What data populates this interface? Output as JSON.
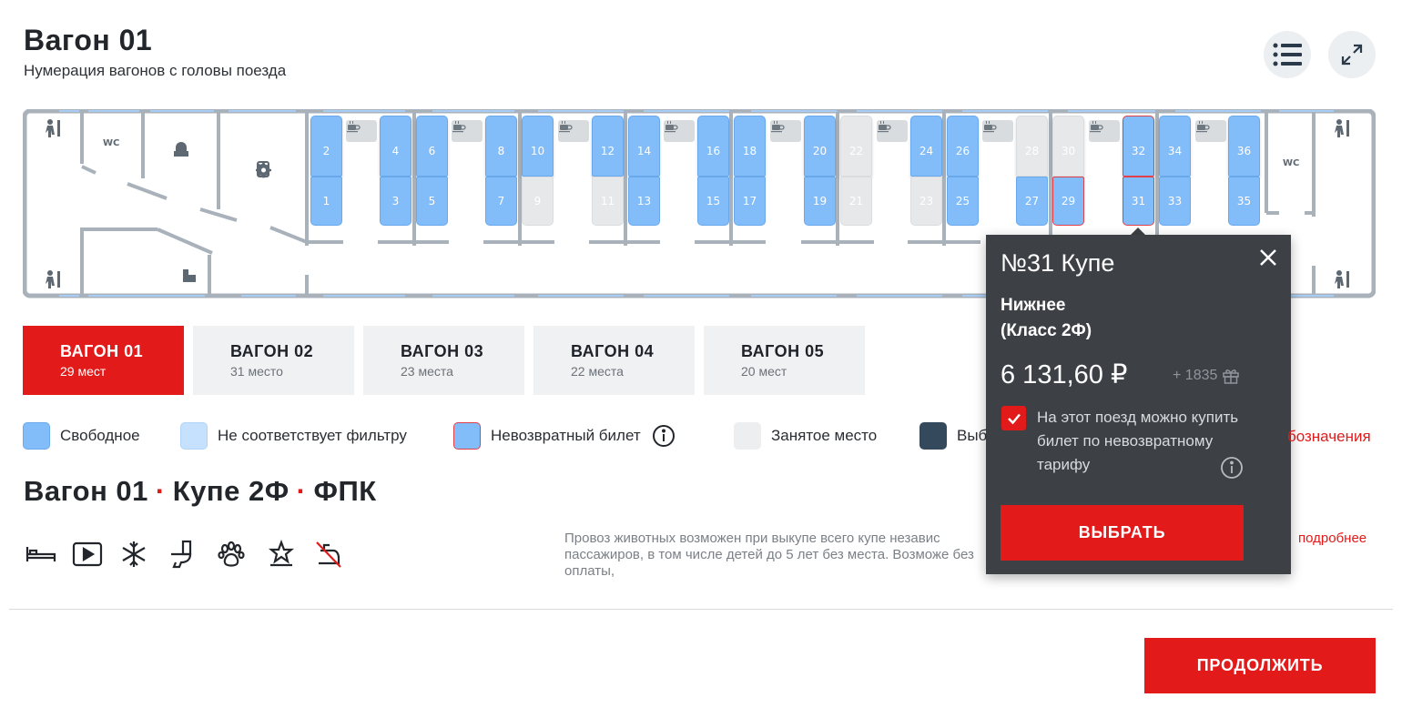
{
  "header": {
    "title": "Вагон 01",
    "subtitle": "Нумерация вагонов с головы поезда",
    "list_icon": "list-icon",
    "expand_icon": "expand-icon"
  },
  "wagon_map": {
    "wc_front": "WC",
    "wc_back": "WC",
    "table_icon": "cup-icon",
    "seats": [
      {
        "n": "2",
        "state": "free"
      },
      {
        "n": "1",
        "state": "free"
      },
      {
        "n": "4",
        "state": "free"
      },
      {
        "n": "3",
        "state": "free"
      },
      {
        "n": "6",
        "state": "free"
      },
      {
        "n": "5",
        "state": "free"
      },
      {
        "n": "8",
        "state": "free"
      },
      {
        "n": "7",
        "state": "free"
      },
      {
        "n": "10",
        "state": "free"
      },
      {
        "n": "9",
        "state": "busy"
      },
      {
        "n": "12",
        "state": "free"
      },
      {
        "n": "11",
        "state": "busy"
      },
      {
        "n": "14",
        "state": "free"
      },
      {
        "n": "13",
        "state": "free"
      },
      {
        "n": "16",
        "state": "free"
      },
      {
        "n": "15",
        "state": "free"
      },
      {
        "n": "18",
        "state": "free"
      },
      {
        "n": "17",
        "state": "free"
      },
      {
        "n": "20",
        "state": "free"
      },
      {
        "n": "19",
        "state": "free"
      },
      {
        "n": "22",
        "state": "busy"
      },
      {
        "n": "21",
        "state": "busy"
      },
      {
        "n": "24",
        "state": "free"
      },
      {
        "n": "23",
        "state": "busy"
      },
      {
        "n": "26",
        "state": "free"
      },
      {
        "n": "25",
        "state": "free"
      },
      {
        "n": "28",
        "state": "busy"
      },
      {
        "n": "27",
        "state": "free"
      },
      {
        "n": "30",
        "state": "busy"
      },
      {
        "n": "29",
        "state": "nonref"
      },
      {
        "n": "32",
        "state": "nonref"
      },
      {
        "n": "31",
        "state": "nonref"
      },
      {
        "n": "34",
        "state": "free"
      },
      {
        "n": "33",
        "state": "free"
      },
      {
        "n": "36",
        "state": "free"
      },
      {
        "n": "35",
        "state": "free"
      }
    ]
  },
  "wagons": [
    {
      "name": "ВАГОН 01",
      "seats": "29 мест",
      "active": true
    },
    {
      "name": "ВАГОН 02",
      "seats": "31 место",
      "active": false
    },
    {
      "name": "ВАГОН 03",
      "seats": "23 места",
      "active": false
    },
    {
      "name": "ВАГОН 04",
      "seats": "22 места",
      "active": false
    },
    {
      "name": "ВАГОН 05",
      "seats": "20 мест",
      "active": false
    }
  ],
  "legend": {
    "free": "Свободное",
    "no_filter": "Не соответствует фильтру",
    "nonrefundable": "Невозвратный билет",
    "occupied": "Занятое место",
    "selected": "Выб",
    "more": "бозначения",
    "colors": {
      "free": "#82bdfa",
      "no_filter": "#c6e1fd",
      "occupied": "#eceef0",
      "selected": "#34495b",
      "nonref_border": "#e0404a"
    }
  },
  "section": {
    "wagon": "Вагон 01",
    "dot": "·",
    "class": "Купе 2Ф",
    "carrier": "ФПК"
  },
  "amenities": [
    "bed-icon",
    "video-icon",
    "snowflake-icon",
    "toilet-icon",
    "paw-icon",
    "star-icon",
    "no-shower-icon"
  ],
  "pets_text": "Провоз животных возможен при выкупе всего купе независ пассажиров, в том числе детей до 5 лет без места. Возможе без оплаты,",
  "pets_more": "подробнее",
  "continue_label": "ПРОДОЛЖИТЬ",
  "popup": {
    "title": "№31 Купе",
    "berth_line1": "Нижнее",
    "berth_line2": "(Класс 2Ф)",
    "price": "6 131,60 ₽",
    "bonus": "+ 1835",
    "checkbox_text": "На этот поезд можно купить билет по невозвратному тарифу",
    "select_label": "ВЫБРАТЬ"
  },
  "accent_color": "#e21a1a"
}
